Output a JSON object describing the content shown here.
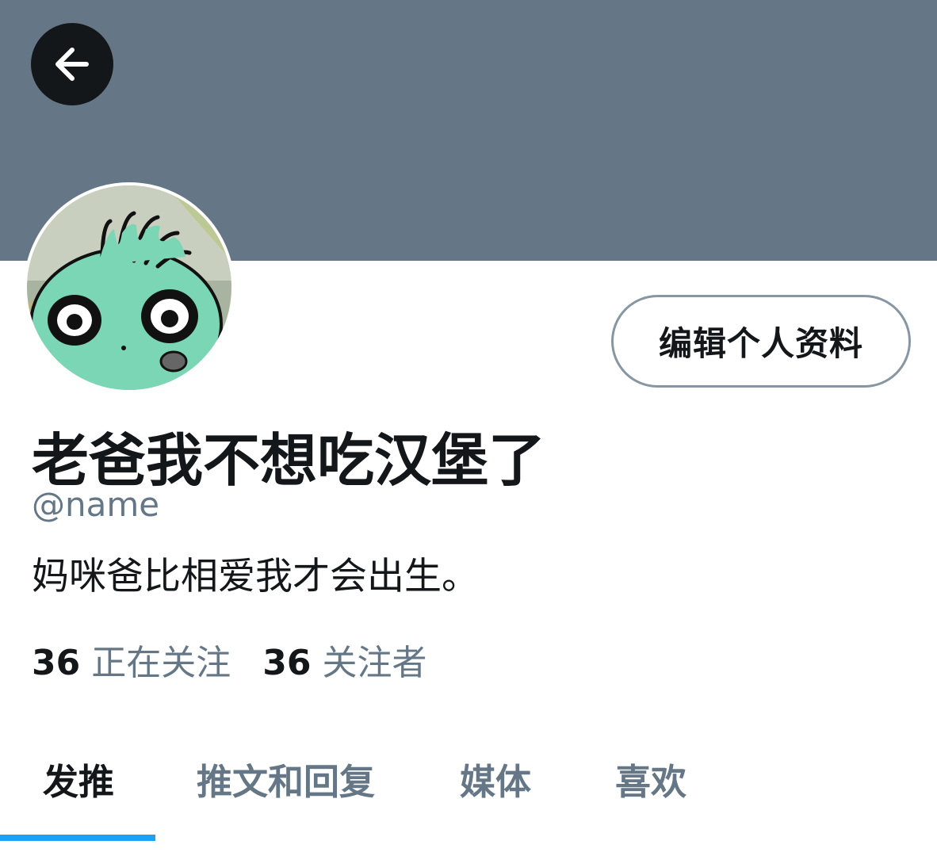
{
  "header": {
    "back_icon": "arrow-left-icon",
    "banner_color": "#657786"
  },
  "profile": {
    "display_name": "老爸我不想吃汉堡了",
    "handle": "@name",
    "bio": "妈咪爸比相爱我才会出生。",
    "edit_button_label": "编辑个人资料",
    "following": {
      "count": "36",
      "label": "正在关注"
    },
    "followers": {
      "count": "36",
      "label": "关注者"
    }
  },
  "tabs": [
    {
      "label": "发推",
      "active": true
    },
    {
      "label": "推文和回复",
      "active": false
    },
    {
      "label": "媒体",
      "active": false
    },
    {
      "label": "喜欢",
      "active": false
    }
  ],
  "colors": {
    "accent": "#1da1f2",
    "text_primary": "#14171a",
    "text_secondary": "#657786"
  }
}
